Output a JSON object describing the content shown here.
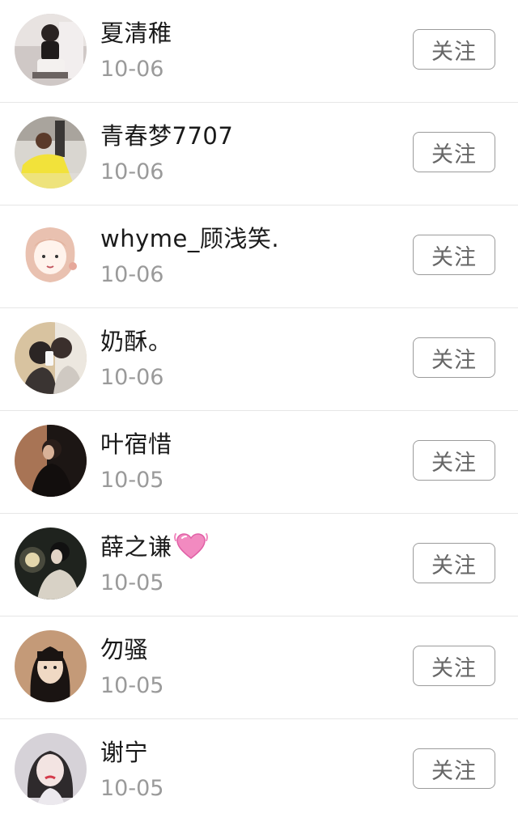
{
  "follow_label": "关注",
  "users": [
    {
      "name": "夏清稚",
      "date": "10-06"
    },
    {
      "name": "青春梦7707",
      "date": "10-06"
    },
    {
      "name": "whyme_顾浅笑.",
      "date": "10-06"
    },
    {
      "name": "奶酥。",
      "date": "10-06"
    },
    {
      "name": "叶宿惜",
      "date": "10-05"
    },
    {
      "name": "薛之谦",
      "date": "10-05",
      "emoji": "heart-icon"
    },
    {
      "name": "勿骚",
      "date": "10-05"
    },
    {
      "name": "谢宁",
      "date": "10-05"
    }
  ]
}
